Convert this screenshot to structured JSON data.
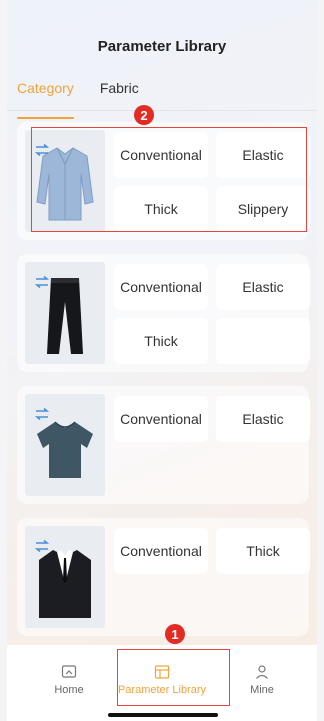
{
  "header": {
    "title": "Parameter Library"
  },
  "tabs": [
    {
      "label": "Category",
      "active": true
    },
    {
      "label": "Fabric",
      "active": false
    }
  ],
  "cards": [
    {
      "icon": "shirt-icon",
      "options": [
        "Conventional",
        "Elastic",
        "Thick",
        "Slippery"
      ]
    },
    {
      "icon": "trousers-icon",
      "options": [
        "Conventional",
        "Elastic",
        "Thick",
        ""
      ]
    },
    {
      "icon": "tshirt-icon",
      "options": [
        "Conventional",
        "Elastic"
      ]
    },
    {
      "icon": "suit-icon",
      "options": [
        "Conventional",
        "Thick"
      ]
    }
  ],
  "annotations": [
    {
      "label": "1",
      "color": "#e22b22"
    },
    {
      "label": "2",
      "color": "#e22b22"
    }
  ],
  "tabbar": {
    "items": [
      {
        "label": "Home",
        "icon": "home-icon",
        "active": false
      },
      {
        "label": "Parameter Library",
        "icon": "library-icon",
        "active": true
      },
      {
        "label": "Mine",
        "icon": "person-icon",
        "active": false
      }
    ]
  },
  "colors": {
    "accent": "#f0a33a",
    "annotation": "#e22b22",
    "swap_icon": "#4a8fd8"
  }
}
